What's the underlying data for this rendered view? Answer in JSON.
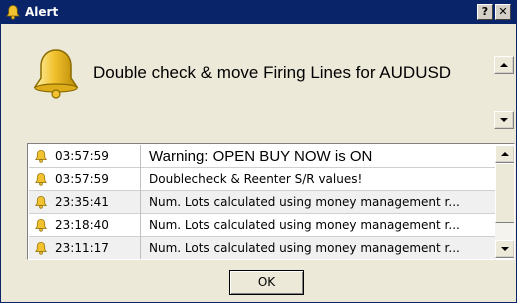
{
  "window": {
    "title": "Alert",
    "help_label": "?",
    "close_label": "✕"
  },
  "message": "Double check & move Firing Lines for AUDUSD",
  "log": {
    "rows": [
      {
        "time": "03:57:59",
        "text": "Warning: OPEN  BUY  NOW is ON"
      },
      {
        "time": "03:57:59",
        "text": "Doublecheck & Reenter S/R values!"
      },
      {
        "time": "23:35:41",
        "text": "Num. Lots calculated using money management r..."
      },
      {
        "time": "23:18:40",
        "text": "Num. Lots calculated using money management r..."
      },
      {
        "time": "23:11:17",
        "text": "Num. Lots calculated using money management r..."
      }
    ]
  },
  "ok_label": "OK",
  "icons": {
    "title": "bell-icon",
    "message": "bell-icon",
    "row": "bell-icon"
  },
  "colors": {
    "titlebar": "#0a246a",
    "dialog": "#ece9d8",
    "bell": "#f2c230"
  }
}
